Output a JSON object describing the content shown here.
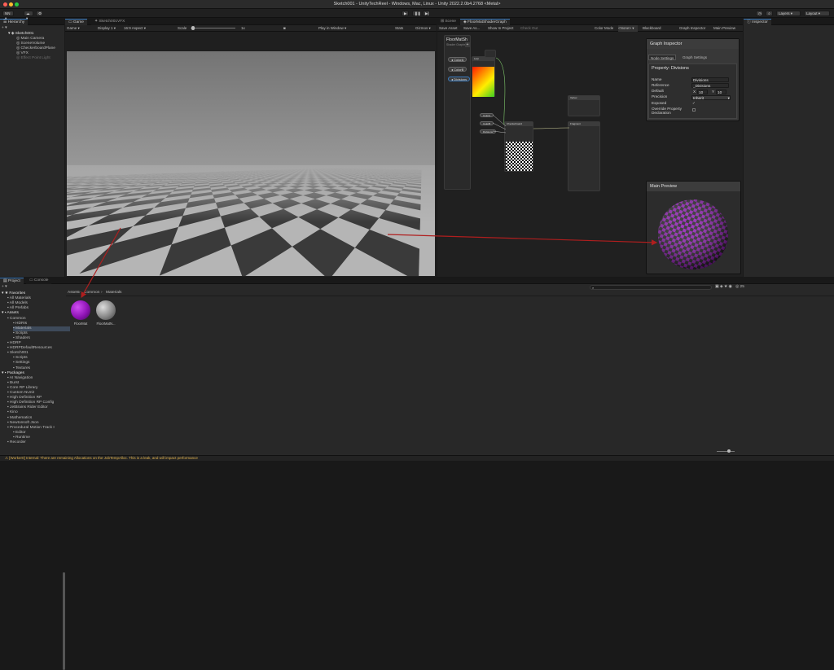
{
  "window": {
    "title": "Sketch001 - UnityTechReel - Windows, Mac, Linux - Unity 2022.2.0b4.2768 <Metal>"
  },
  "toolbar": {
    "account": "NN",
    "layers": "Layers",
    "layout": "Layout"
  },
  "hierarchy": {
    "tab": "Hierarchy",
    "scene": "Sketch001",
    "items": [
      "Main Camera",
      "SceneVolume",
      "CheckerboardPlane",
      "VFX",
      "Effect Point Light"
    ]
  },
  "game": {
    "tabs": [
      "Game",
      "Sketch001VFX"
    ],
    "mode": "Game",
    "display": "Display 1",
    "aspect": "16:9 Aspect",
    "scale_label": "Scale",
    "scale_value": "1x",
    "play_in": "Play in Window",
    "stats": "Stats",
    "gizmos": "Gizmos"
  },
  "shadergraph": {
    "tabs": [
      "Scene",
      "FloorMatShaderGraph"
    ],
    "toolbar": [
      "Save Asset",
      "Save As...",
      "Show In Project",
      "Check Out"
    ],
    "color_mode_label": "Color Mode",
    "color_mode_value": "<None>",
    "right_buttons": [
      "Blackboard",
      "Graph Inspector",
      "Main Preview"
    ],
    "blackboard": {
      "title": "FloorMatSh",
      "subtitle": "Shader Graphs",
      "properties": [
        "ColorA",
        "ColorB",
        "Divisions"
      ]
    },
    "nodes": {
      "checker": "Checkerboard",
      "vertex": "Vertex",
      "fragment": "Fragment",
      "lerp": "Lerp"
    }
  },
  "graph_inspector": {
    "title": "Graph Inspector",
    "tabs": [
      "Node Settings",
      "Graph Settings"
    ],
    "header": "Property: Divisions",
    "fields": [
      {
        "label": "Name",
        "value": "Divisions"
      },
      {
        "label": "Reference",
        "value": "_Divisions"
      },
      {
        "label": "Default",
        "x": "10",
        "y": "10"
      },
      {
        "label": "Precision",
        "value": "Inherit"
      },
      {
        "label": "Exposed",
        "value": "✓"
      },
      {
        "label": "Override Property Declaration",
        "value": ""
      }
    ]
  },
  "main_preview": {
    "title": "Main Preview"
  },
  "inspector": {
    "tab": "Inspector"
  },
  "project": {
    "tabs": [
      "Project",
      "Console"
    ],
    "tree": [
      {
        "label": "Favorites",
        "indent": 0
      },
      {
        "label": "All Materials",
        "indent": 1
      },
      {
        "label": "All Models",
        "indent": 1
      },
      {
        "label": "All Prefabs",
        "indent": 1
      },
      {
        "label": "Assets",
        "indent": 0
      },
      {
        "label": "Common",
        "indent": 1
      },
      {
        "label": "HDRIs",
        "indent": 2
      },
      {
        "label": "Materials",
        "indent": 2
      },
      {
        "label": "Scripts",
        "indent": 2
      },
      {
        "label": "Shaders",
        "indent": 2
      },
      {
        "label": "HDRP",
        "indent": 1
      },
      {
        "label": "HDRPDefaultResources",
        "indent": 1
      },
      {
        "label": "Sketch001",
        "indent": 1
      },
      {
        "label": "Scripts",
        "indent": 2
      },
      {
        "label": "Settings",
        "indent": 2
      },
      {
        "label": "Textures",
        "indent": 2
      },
      {
        "label": "Packages",
        "indent": 0
      },
      {
        "label": "AI Navigation",
        "indent": 1
      },
      {
        "label": "Burst",
        "indent": 1
      },
      {
        "label": "Core RP Library",
        "indent": 1
      },
      {
        "label": "Custom NUnit",
        "indent": 1
      },
      {
        "label": "High Definition RP",
        "indent": 1
      },
      {
        "label": "High Definition RP Config",
        "indent": 1
      },
      {
        "label": "JetBrains Rider Editor",
        "indent": 1
      },
      {
        "label": "Kino",
        "indent": 1
      },
      {
        "label": "Mathematics",
        "indent": 1
      },
      {
        "label": "Newtonsoft Json",
        "indent": 1
      },
      {
        "label": "Procedural Motion Track I",
        "indent": 1
      },
      {
        "label": "Editor",
        "indent": 2
      },
      {
        "label": "Runtime",
        "indent": 2
      },
      {
        "label": "Recorder",
        "indent": 1
      }
    ],
    "breadcrumb": [
      "Assets",
      "Common",
      "Materials"
    ],
    "assets": [
      {
        "name": "FloorMat"
      },
      {
        "name": "FloorMatN..."
      }
    ],
    "count": "25"
  },
  "status": {
    "message": "[Worker0] Internal: There are remaining Allocations on the JobTempAlloc. This is a leak, and will impact performance"
  },
  "colors": {
    "accent": "#3a79bb",
    "purple": "#8e13b5",
    "arrow": "#b01e1e"
  }
}
